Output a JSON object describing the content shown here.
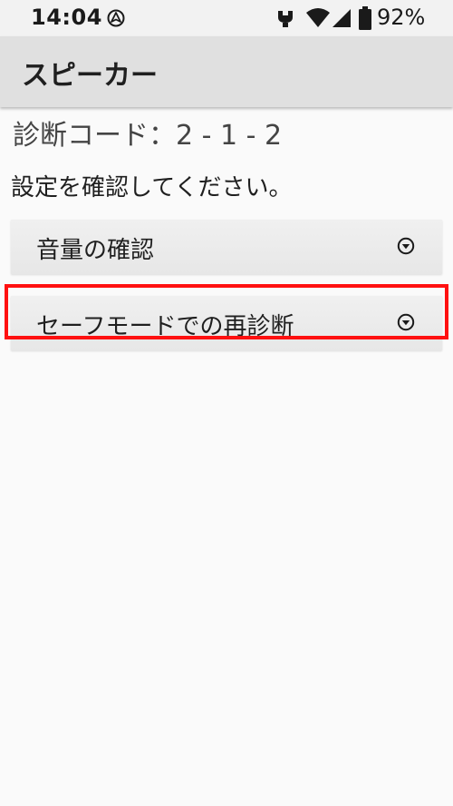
{
  "status_bar": {
    "time": "14:04",
    "battery_percent": "92%",
    "icons": [
      "navigation-icon",
      "nfc-icon",
      "wifi-icon",
      "cellular-signal-icon",
      "battery-icon"
    ]
  },
  "app_bar": {
    "title": "スピーカー"
  },
  "content": {
    "diagnosis_code": "診断コード：2 - 1 - 2",
    "instruction": "設定を確認してください。",
    "items": [
      {
        "label": "音量の確認",
        "icon": "chevron-down-circle-icon"
      },
      {
        "label": "セーフモードでの再診断",
        "icon": "chevron-down-circle-icon"
      }
    ]
  },
  "colors": {
    "background": "#fafafa",
    "status_bar": "#f2f2f2",
    "app_bar": "#e0e0e0",
    "highlight": "#ff1010"
  }
}
